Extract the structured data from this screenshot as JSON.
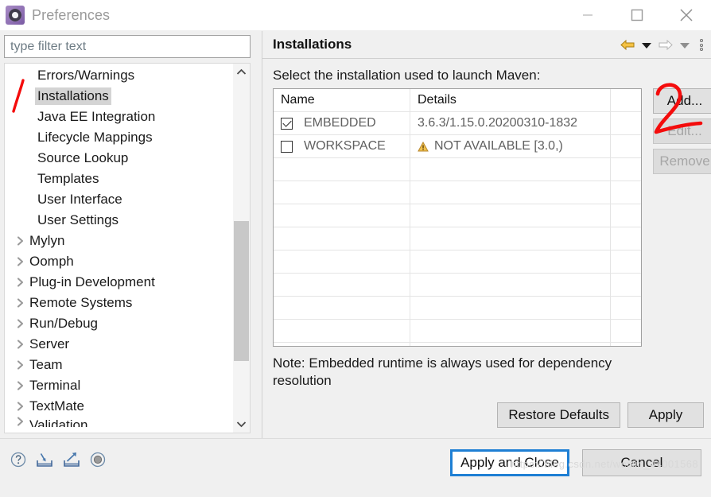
{
  "window": {
    "title": "Preferences",
    "app_icon": "gear-icon",
    "controls": {
      "minimize": "minimize-icon",
      "maximize": "maximize-icon",
      "close": "close-icon"
    }
  },
  "sidebar": {
    "filter": {
      "value": "",
      "placeholder": "type filter text"
    },
    "items": [
      {
        "label": "Errors/Warnings",
        "type": "leaf",
        "selected": false
      },
      {
        "label": "Installations",
        "type": "leaf",
        "selected": true
      },
      {
        "label": "Java EE Integration",
        "type": "leaf",
        "selected": false
      },
      {
        "label": "Lifecycle Mappings",
        "type": "leaf",
        "selected": false
      },
      {
        "label": "Source Lookup",
        "type": "leaf",
        "selected": false
      },
      {
        "label": "Templates",
        "type": "leaf",
        "selected": false
      },
      {
        "label": "User Interface",
        "type": "leaf",
        "selected": false
      },
      {
        "label": "User Settings",
        "type": "leaf",
        "selected": false
      },
      {
        "label": "Mylyn",
        "type": "branch",
        "selected": false
      },
      {
        "label": "Oomph",
        "type": "branch",
        "selected": false
      },
      {
        "label": "Plug-in Development",
        "type": "branch",
        "selected": false
      },
      {
        "label": "Remote Systems",
        "type": "branch",
        "selected": false
      },
      {
        "label": "Run/Debug",
        "type": "branch",
        "selected": false
      },
      {
        "label": "Server",
        "type": "branch",
        "selected": false
      },
      {
        "label": "Team",
        "type": "branch",
        "selected": false
      },
      {
        "label": "Terminal",
        "type": "branch",
        "selected": false
      },
      {
        "label": "TextMate",
        "type": "branch",
        "selected": false
      },
      {
        "label": "Validation",
        "type": "branch",
        "selected": false
      }
    ],
    "scrollbar": {
      "up": "chevron-up-icon",
      "down": "chevron-down-icon"
    }
  },
  "main": {
    "title": "Installations",
    "nav": {
      "back": "back-arrow-icon",
      "back_menu": "chevron-down-icon",
      "forward": "forward-arrow-icon",
      "forward_menu": "chevron-down-icon",
      "overflow": "vertical-dots-icon"
    },
    "description": "Select the installation used to launch Maven:",
    "table": {
      "columns": [
        "Name",
        "Details",
        ""
      ],
      "rows": [
        {
          "checked": true,
          "name": "EMBEDDED",
          "details": "3.6.3/1.15.0.20200310-1832",
          "warning": false
        },
        {
          "checked": false,
          "name": "WORKSPACE",
          "details": "NOT AVAILABLE [3.0,)",
          "warning": true
        }
      ],
      "empty_row_count": 9
    },
    "side_buttons": [
      {
        "label": "Add...",
        "enabled": true
      },
      {
        "label": "Edit...",
        "enabled": false
      },
      {
        "label": "Remove",
        "enabled": false
      }
    ],
    "note": "Note: Embedded runtime is always used for dependency resolution",
    "footer_buttons": [
      {
        "label": "Restore Defaults"
      },
      {
        "label": "Apply"
      }
    ]
  },
  "bottom_bar": {
    "icons": [
      {
        "name": "help-icon"
      },
      {
        "name": "import-icon"
      },
      {
        "name": "export-icon"
      },
      {
        "name": "record-icon"
      }
    ],
    "buttons": [
      {
        "label": "Apply and Close",
        "focused": true
      },
      {
        "label": "Cancel",
        "focused": false
      }
    ]
  },
  "watermark": "https://blog.csdn.net/weixin_44001568",
  "annotations": [
    {
      "name": "annotation-stroke-1",
      "text": "/"
    },
    {
      "name": "annotation-number-2",
      "text": "2"
    }
  ],
  "colors": {
    "accent_blue": "#1e7fd4",
    "warning_orange": "#e8a33d",
    "annotation_red": "#f40c0c",
    "selection_gray": "#d4d4d4"
  }
}
